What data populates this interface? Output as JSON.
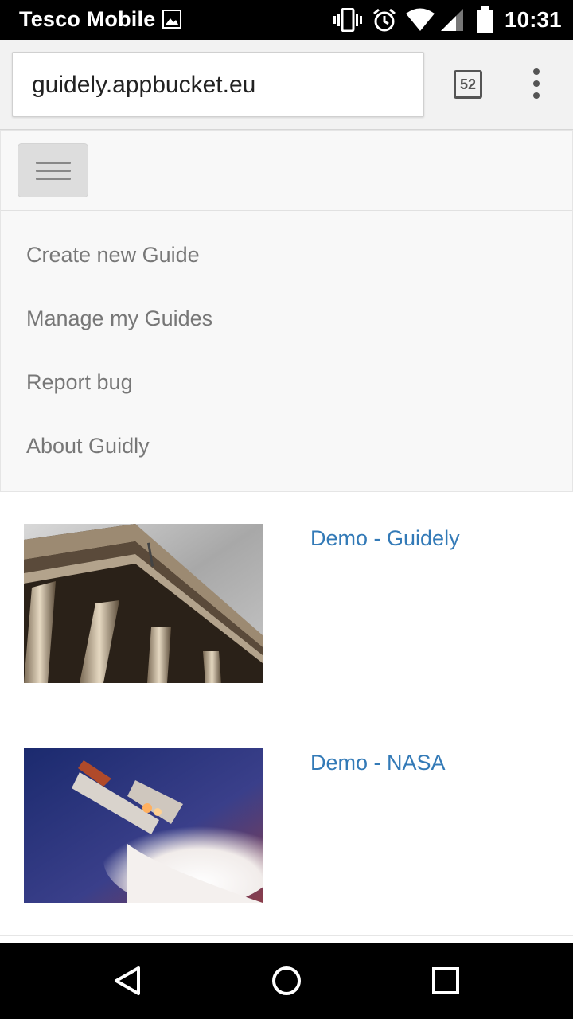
{
  "status_bar": {
    "carrier": "Tesco Mobile",
    "time": "10:31"
  },
  "browser": {
    "url": "guidely.appbucket.eu",
    "tab_count": "52"
  },
  "nav": {
    "items": [
      {
        "label": "Create new Guide"
      },
      {
        "label": "Manage my Guides"
      },
      {
        "label": "Report bug"
      },
      {
        "label": "About Guidly"
      }
    ]
  },
  "guides": [
    {
      "title": "Demo - Guidely",
      "thumbnail": "building-columns-photo"
    },
    {
      "title": "Demo - NASA",
      "thumbnail": "space-shuttle-launch-photo"
    }
  ],
  "colors": {
    "link": "#337ab7",
    "nav_text": "#777777",
    "navbar_bg": "#f8f8f8"
  }
}
